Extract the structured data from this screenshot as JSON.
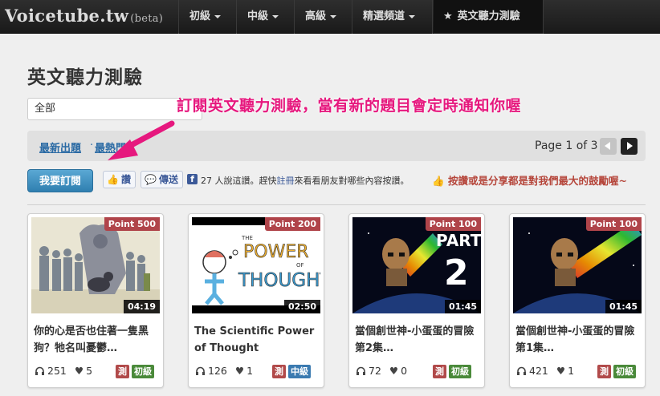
{
  "site": {
    "logo": "Voicetube.tw",
    "beta": "(beta)"
  },
  "nav": {
    "items": [
      {
        "label": "初級"
      },
      {
        "label": "中級"
      },
      {
        "label": "高級"
      },
      {
        "label": "精選頻道"
      },
      {
        "label": "英文聽力測驗"
      }
    ]
  },
  "page": {
    "title": "英文聽力測驗"
  },
  "filter": {
    "selected": "全部"
  },
  "annotation": "訂閱英文聽力測驗，當有新的題目會定時通知你喔",
  "sort": {
    "newest": "最新出題",
    "separator": "·",
    "popular": "最熱門"
  },
  "pagination": {
    "text": "Page 1 of 3"
  },
  "actions": {
    "subscribe": "我要訂閱",
    "like": "讚",
    "send": "傳送",
    "fb_count": "27",
    "fb_text_a": "人說這讚。趕快",
    "fb_register": "註冊",
    "fb_text_b": "來看看朋友對哪些內容按讚。",
    "encourage": "按讚或是分享都是對我們最大的鼓勵喔~"
  },
  "cards": [
    {
      "point": "Point 500",
      "duration": "04:19",
      "title": "你的心是否也住著一隻黑狗？牠名叫憂鬱…",
      "listens": "251",
      "likes": "5",
      "tag": "測",
      "level": "初級"
    },
    {
      "point": "Point 200",
      "duration": "02:50",
      "title": "The Scientific Power of Thought",
      "listens": "126",
      "likes": "1",
      "tag": "測",
      "level": "中級"
    },
    {
      "point": "Point 100",
      "duration": "01:45",
      "title": "當個創世神-小蛋蛋的冒險第2集…",
      "listens": "72",
      "likes": "0",
      "tag": "測",
      "level": "初級"
    },
    {
      "point": "Point 100",
      "duration": "01:45",
      "title": "當個創世神-小蛋蛋的冒險第1集…",
      "listens": "421",
      "likes": "1",
      "tag": "測",
      "level": "初級"
    }
  ],
  "thumbnail_text": {
    "power": "POWER",
    "thought": "THOUGHT",
    "the": "THE",
    "of": "OF",
    "part": "PART",
    "num": "2"
  },
  "colors": {
    "accent": "#e6187e",
    "point": "#b0444a",
    "link": "#2a6aa4",
    "facebook": "#3b5998"
  }
}
